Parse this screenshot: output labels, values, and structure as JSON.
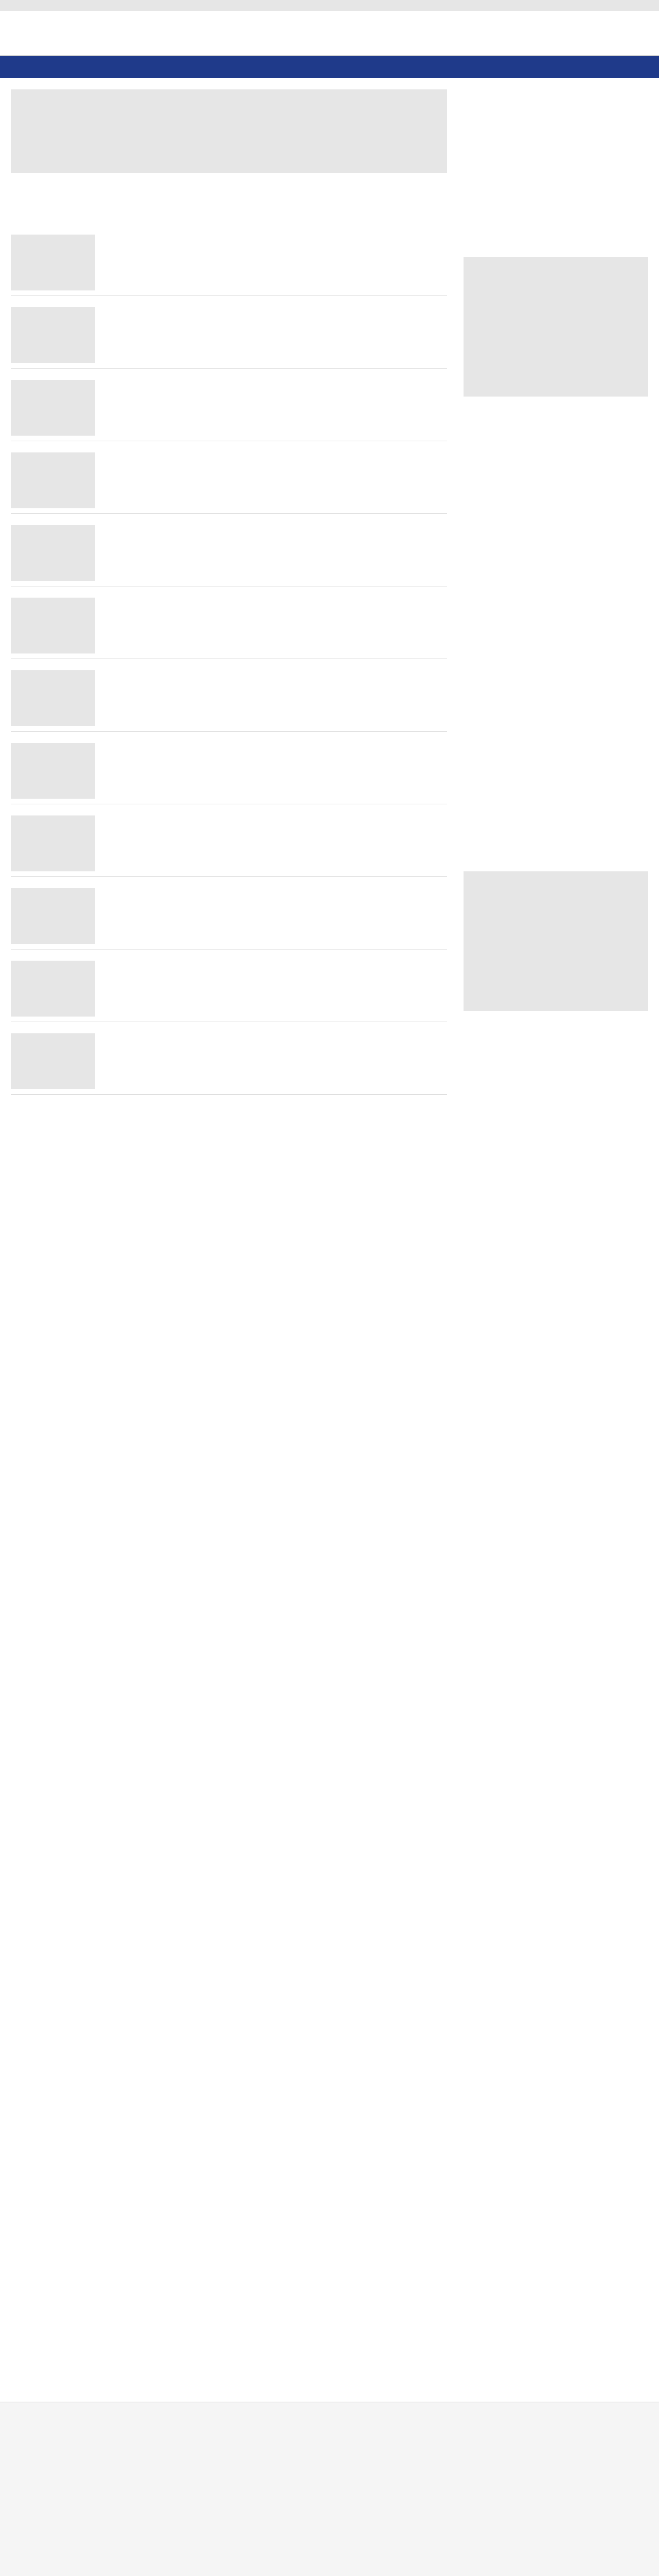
{
  "address_bar": "",
  "site_title": "",
  "nav_items": [
    "",
    "",
    "",
    "",
    "",
    "",
    ""
  ],
  "articles": [
    "",
    "",
    "",
    "",
    "",
    "",
    "",
    "",
    "",
    "",
    "",
    ""
  ],
  "footer_text": ""
}
